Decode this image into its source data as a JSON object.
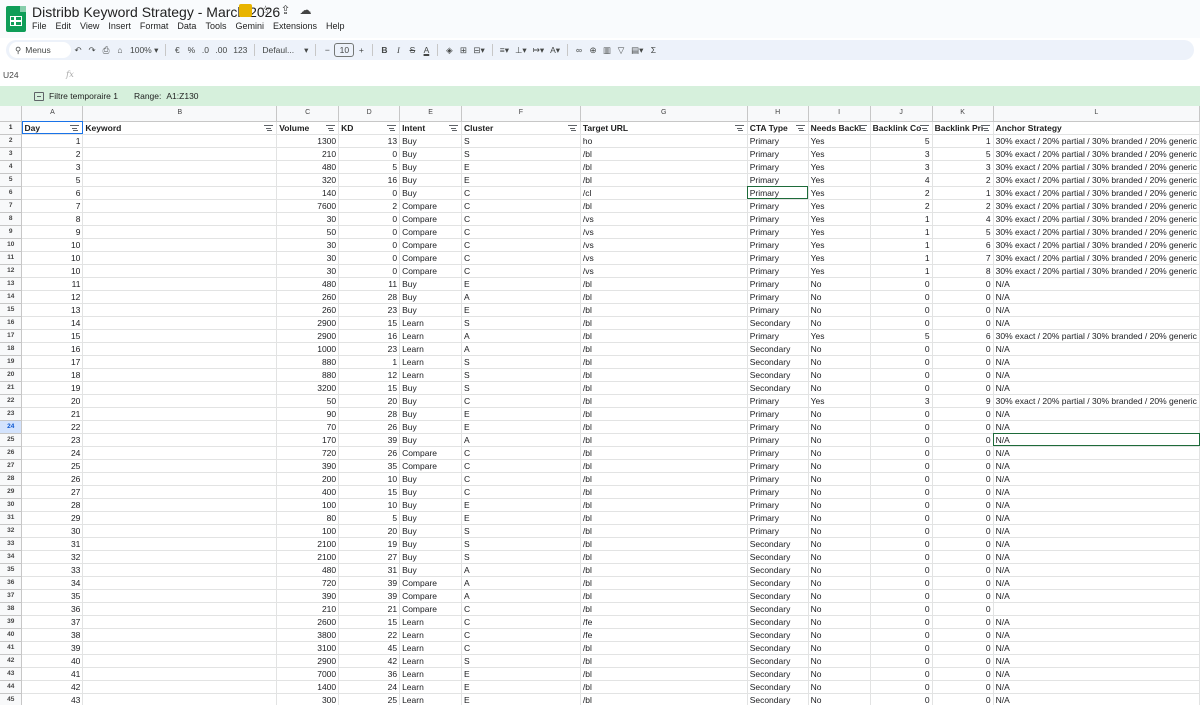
{
  "window": {
    "title": "Distribb Keyword Strategy - March 2026"
  },
  "menu": [
    "File",
    "Edit",
    "View",
    "Insert",
    "Format",
    "Data",
    "Tools",
    "Gemini",
    "Extensions",
    "Help"
  ],
  "toolbar": {
    "menus_label": "Menus",
    "zoom": "100%",
    "currency": "€",
    "percent": "%",
    "decrease_decimal": ".0",
    "increase_decimal": ".00",
    "number_format": "123",
    "font": "Defaul...",
    "font_size": "10",
    "bold": "B",
    "italic": "I",
    "strikethrough": "S",
    "text_color": "A",
    "sum": "Σ"
  },
  "formula_bar": {
    "cell_ref": "U24",
    "fx": "fx",
    "content": ""
  },
  "filter_bar": {
    "name": "Filtre temporaire 1",
    "range_label": "Range:",
    "range": "A1:Z130"
  },
  "columns": [
    "A",
    "B",
    "C",
    "D",
    "E",
    "F",
    "G",
    "H",
    "I",
    "J",
    "K",
    "L"
  ],
  "headers": [
    "Day",
    "Keyword",
    "Volume",
    "KD",
    "Intent",
    "Cluster",
    "Target URL",
    "CTA Type",
    "Needs Backl",
    "Backlink Co",
    "Backlink Pri",
    "Anchor Strategy"
  ],
  "rows": [
    {
      "n": "2",
      "day": "1",
      "kw": "",
      "vol": "1300",
      "kd": "13",
      "intent": "Buy",
      "cluster": "S",
      "url": "ho",
      "cta": "Primary",
      "needs": "Yes",
      "bc": "5",
      "bp": "1",
      "anchor": "30% exact / 20% partial / 30% branded / 20% generic"
    },
    {
      "n": "3",
      "day": "2",
      "kw": "",
      "vol": "210",
      "kd": "0",
      "intent": "Buy",
      "cluster": "S",
      "url": "/bl",
      "cta": "Primary",
      "needs": "Yes",
      "bc": "3",
      "bp": "5",
      "anchor": "30% exact / 20% partial / 30% branded / 20% generic"
    },
    {
      "n": "4",
      "day": "3",
      "kw": "",
      "vol": "480",
      "kd": "5",
      "intent": "Buy",
      "cluster": "E",
      "url": "/bl",
      "cta": "Primary",
      "needs": "Yes",
      "bc": "3",
      "bp": "3",
      "anchor": "30% exact / 20% partial / 30% branded / 20% generic"
    },
    {
      "n": "5",
      "day": "5",
      "kw": "",
      "vol": "320",
      "kd": "16",
      "intent": "Buy",
      "cluster": "E",
      "url": "/bl",
      "cta": "Primary",
      "needs": "Yes",
      "bc": "4",
      "bp": "2",
      "anchor": "30% exact / 20% partial / 30% branded / 20% generic"
    },
    {
      "n": "6",
      "day": "6",
      "kw": "",
      "vol": "140",
      "kd": "0",
      "intent": "Buy",
      "cluster": "C",
      "url": "/cl",
      "cta": "Primary",
      "needs": "Yes",
      "bc": "2",
      "bp": "1",
      "anchor": "30% exact / 20% partial / 30% branded / 20% generic"
    },
    {
      "n": "7",
      "day": "7",
      "kw": "",
      "vol": "7600",
      "kd": "2",
      "intent": "Compare",
      "cluster": "C",
      "url": "/bl",
      "cta": "Primary",
      "needs": "Yes",
      "bc": "2",
      "bp": "2",
      "anchor": "30% exact / 20% partial / 30% branded / 20% generic"
    },
    {
      "n": "8",
      "day": "8",
      "kw": "",
      "vol": "30",
      "kd": "0",
      "intent": "Compare",
      "cluster": "C",
      "url": "/vs",
      "cta": "Primary",
      "needs": "Yes",
      "bc": "1",
      "bp": "4",
      "anchor": "30% exact / 20% partial / 30% branded / 20% generic"
    },
    {
      "n": "9",
      "day": "9",
      "kw": "",
      "vol": "50",
      "kd": "0",
      "intent": "Compare",
      "cluster": "C",
      "url": "/vs",
      "cta": "Primary",
      "needs": "Yes",
      "bc": "1",
      "bp": "5",
      "anchor": "30% exact / 20% partial / 30% branded / 20% generic"
    },
    {
      "n": "10",
      "day": "10",
      "kw": "",
      "vol": "30",
      "kd": "0",
      "intent": "Compare",
      "cluster": "C",
      "url": "/vs",
      "cta": "Primary",
      "needs": "Yes",
      "bc": "1",
      "bp": "6",
      "anchor": "30% exact / 20% partial / 30% branded / 20% generic"
    },
    {
      "n": "11",
      "day": "10",
      "kw": "",
      "vol": "30",
      "kd": "0",
      "intent": "Compare",
      "cluster": "C",
      "url": "/vs",
      "cta": "Primary",
      "needs": "Yes",
      "bc": "1",
      "bp": "7",
      "anchor": "30% exact / 20% partial / 30% branded / 20% generic"
    },
    {
      "n": "12",
      "day": "10",
      "kw": "",
      "vol": "30",
      "kd": "0",
      "intent": "Compare",
      "cluster": "C",
      "url": "/vs",
      "cta": "Primary",
      "needs": "Yes",
      "bc": "1",
      "bp": "8",
      "anchor": "30% exact / 20% partial / 30% branded / 20% generic"
    },
    {
      "n": "13",
      "day": "11",
      "kw": "",
      "vol": "480",
      "kd": "11",
      "intent": "Buy",
      "cluster": "E",
      "url": "/bl",
      "cta": "Primary",
      "needs": "No",
      "bc": "0",
      "bp": "0",
      "anchor": "N/A"
    },
    {
      "n": "14",
      "day": "12",
      "kw": "",
      "vol": "260",
      "kd": "28",
      "intent": "Buy",
      "cluster": "A",
      "url": "/bl",
      "cta": "Primary",
      "needs": "No",
      "bc": "0",
      "bp": "0",
      "anchor": "N/A"
    },
    {
      "n": "15",
      "day": "13",
      "kw": "",
      "vol": "260",
      "kd": "23",
      "intent": "Buy",
      "cluster": "E",
      "url": "/bl",
      "cta": "Primary",
      "needs": "No",
      "bc": "0",
      "bp": "0",
      "anchor": "N/A"
    },
    {
      "n": "16",
      "day": "14",
      "kw": "",
      "vol": "2900",
      "kd": "15",
      "intent": "Learn",
      "cluster": "S",
      "url": "/bl",
      "cta": "Secondary",
      "needs": "No",
      "bc": "0",
      "bp": "0",
      "anchor": "N/A"
    },
    {
      "n": "17",
      "day": "15",
      "kw": "",
      "vol": "2900",
      "kd": "16",
      "intent": "Learn",
      "cluster": "A",
      "url": "/bl",
      "cta": "Primary",
      "needs": "Yes",
      "bc": "5",
      "bp": "6",
      "anchor": "30% exact / 20% partial / 30% branded / 20% generic"
    },
    {
      "n": "18",
      "day": "16",
      "kw": "",
      "vol": "1000",
      "kd": "23",
      "intent": "Learn",
      "cluster": "A",
      "url": "/bl",
      "cta": "Secondary",
      "needs": "No",
      "bc": "0",
      "bp": "0",
      "anchor": "N/A"
    },
    {
      "n": "19",
      "day": "17",
      "kw": "",
      "vol": "880",
      "kd": "1",
      "intent": "Learn",
      "cluster": "S",
      "url": "/bl",
      "cta": "Secondary",
      "needs": "No",
      "bc": "0",
      "bp": "0",
      "anchor": "N/A"
    },
    {
      "n": "20",
      "day": "18",
      "kw": "",
      "vol": "880",
      "kd": "12",
      "intent": "Learn",
      "cluster": "S",
      "url": "/bl",
      "cta": "Secondary",
      "needs": "No",
      "bc": "0",
      "bp": "0",
      "anchor": "N/A"
    },
    {
      "n": "21",
      "day": "19",
      "kw": "",
      "vol": "3200",
      "kd": "15",
      "intent": "Buy",
      "cluster": "S",
      "url": "/bl",
      "cta": "Secondary",
      "needs": "No",
      "bc": "0",
      "bp": "0",
      "anchor": "N/A"
    },
    {
      "n": "22",
      "day": "20",
      "kw": "",
      "vol": "50",
      "kd": "20",
      "intent": "Buy",
      "cluster": "C",
      "url": "/bl",
      "cta": "Primary",
      "needs": "Yes",
      "bc": "3",
      "bp": "9",
      "anchor": "30% exact / 20% partial / 30% branded / 20% generic"
    },
    {
      "n": "23",
      "day": "21",
      "kw": "",
      "vol": "90",
      "kd": "28",
      "intent": "Buy",
      "cluster": "E",
      "url": "/bl",
      "cta": "Primary",
      "needs": "No",
      "bc": "0",
      "bp": "0",
      "anchor": "N/A"
    },
    {
      "n": "24",
      "day": "22",
      "kw": "",
      "vol": "70",
      "kd": "26",
      "intent": "Buy",
      "cluster": "E",
      "url": "/bl",
      "cta": "Primary",
      "needs": "No",
      "bc": "0",
      "bp": "0",
      "anchor": "N/A"
    },
    {
      "n": "25",
      "day": "23",
      "kw": "",
      "vol": "170",
      "kd": "39",
      "intent": "Buy",
      "cluster": "A",
      "url": "/bl",
      "cta": "Primary",
      "needs": "No",
      "bc": "0",
      "bp": "0",
      "anchor": "N/A"
    },
    {
      "n": "26",
      "day": "24",
      "kw": "",
      "vol": "720",
      "kd": "26",
      "intent": "Compare",
      "cluster": "C",
      "url": "/bl",
      "cta": "Primary",
      "needs": "No",
      "bc": "0",
      "bp": "0",
      "anchor": "N/A"
    },
    {
      "n": "27",
      "day": "25",
      "kw": "",
      "vol": "390",
      "kd": "35",
      "intent": "Compare",
      "cluster": "C",
      "url": "/bl",
      "cta": "Primary",
      "needs": "No",
      "bc": "0",
      "bp": "0",
      "anchor": "N/A"
    },
    {
      "n": "28",
      "day": "26",
      "kw": "",
      "vol": "200",
      "kd": "10",
      "intent": "Buy",
      "cluster": "C",
      "url": "/bl",
      "cta": "Primary",
      "needs": "No",
      "bc": "0",
      "bp": "0",
      "anchor": "N/A"
    },
    {
      "n": "29",
      "day": "27",
      "kw": "",
      "vol": "400",
      "kd": "15",
      "intent": "Buy",
      "cluster": "C",
      "url": "/bl",
      "cta": "Primary",
      "needs": "No",
      "bc": "0",
      "bp": "0",
      "anchor": "N/A"
    },
    {
      "n": "30",
      "day": "28",
      "kw": "",
      "vol": "100",
      "kd": "10",
      "intent": "Buy",
      "cluster": "E",
      "url": "/bl",
      "cta": "Primary",
      "needs": "No",
      "bc": "0",
      "bp": "0",
      "anchor": "N/A"
    },
    {
      "n": "31",
      "day": "29",
      "kw": "",
      "vol": "80",
      "kd": "5",
      "intent": "Buy",
      "cluster": "E",
      "url": "/bl",
      "cta": "Primary",
      "needs": "No",
      "bc": "0",
      "bp": "0",
      "anchor": "N/A"
    },
    {
      "n": "32",
      "day": "30",
      "kw": "",
      "vol": "100",
      "kd": "20",
      "intent": "Buy",
      "cluster": "S",
      "url": "/bl",
      "cta": "Primary",
      "needs": "No",
      "bc": "0",
      "bp": "0",
      "anchor": "N/A"
    },
    {
      "n": "33",
      "day": "31",
      "kw": "",
      "vol": "2100",
      "kd": "19",
      "intent": "Buy",
      "cluster": "S",
      "url": "/bl",
      "cta": "Secondary",
      "needs": "No",
      "bc": "0",
      "bp": "0",
      "anchor": "N/A"
    },
    {
      "n": "34",
      "day": "32",
      "kw": "",
      "vol": "2100",
      "kd": "27",
      "intent": "Buy",
      "cluster": "S",
      "url": "/bl",
      "cta": "Secondary",
      "needs": "No",
      "bc": "0",
      "bp": "0",
      "anchor": "N/A"
    },
    {
      "n": "35",
      "day": "33",
      "kw": "",
      "vol": "480",
      "kd": "31",
      "intent": "Buy",
      "cluster": "A",
      "url": "/bl",
      "cta": "Secondary",
      "needs": "No",
      "bc": "0",
      "bp": "0",
      "anchor": "N/A"
    },
    {
      "n": "36",
      "day": "34",
      "kw": "",
      "vol": "720",
      "kd": "39",
      "intent": "Compare",
      "cluster": "A",
      "url": "/bl",
      "cta": "Secondary",
      "needs": "No",
      "bc": "0",
      "bp": "0",
      "anchor": "N/A"
    },
    {
      "n": "37",
      "day": "35",
      "kw": "",
      "vol": "390",
      "kd": "39",
      "intent": "Compare",
      "cluster": "A",
      "url": "/bl",
      "cta": "Secondary",
      "needs": "No",
      "bc": "0",
      "bp": "0",
      "anchor": "N/A"
    },
    {
      "n": "38",
      "day": "36",
      "kw": "",
      "vol": "210",
      "kd": "21",
      "intent": "Compare",
      "cluster": "C",
      "url": "/bl",
      "cta": "Secondary",
      "needs": "No",
      "bc": "0",
      "bp": "0",
      "anchor": ""
    },
    {
      "n": "39",
      "day": "37",
      "kw": "",
      "vol": "2600",
      "kd": "15",
      "intent": "Learn",
      "cluster": "C",
      "url": "/fe",
      "cta": "Secondary",
      "needs": "No",
      "bc": "0",
      "bp": "0",
      "anchor": "N/A"
    },
    {
      "n": "40",
      "day": "38",
      "kw": "",
      "vol": "3800",
      "kd": "22",
      "intent": "Learn",
      "cluster": "C",
      "url": "/fe",
      "cta": "Secondary",
      "needs": "No",
      "bc": "0",
      "bp": "0",
      "anchor": "N/A"
    },
    {
      "n": "41",
      "day": "39",
      "kw": "",
      "vol": "3100",
      "kd": "45",
      "intent": "Learn",
      "cluster": "C",
      "url": "/bl",
      "cta": "Secondary",
      "needs": "No",
      "bc": "0",
      "bp": "0",
      "anchor": "N/A"
    },
    {
      "n": "42",
      "day": "40",
      "kw": "",
      "vol": "2900",
      "kd": "42",
      "intent": "Learn",
      "cluster": "S",
      "url": "/bl",
      "cta": "Secondary",
      "needs": "No",
      "bc": "0",
      "bp": "0",
      "anchor": "N/A"
    },
    {
      "n": "43",
      "day": "41",
      "kw": "",
      "vol": "7000",
      "kd": "36",
      "intent": "Learn",
      "cluster": "E",
      "url": "/bl",
      "cta": "Secondary",
      "needs": "No",
      "bc": "0",
      "bp": "0",
      "anchor": "N/A"
    },
    {
      "n": "44",
      "day": "42",
      "kw": "",
      "vol": "1400",
      "kd": "24",
      "intent": "Learn",
      "cluster": "E",
      "url": "/bl",
      "cta": "Secondary",
      "needs": "No",
      "bc": "0",
      "bp": "0",
      "anchor": "N/A"
    },
    {
      "n": "45",
      "day": "43",
      "kw": "",
      "vol": "300",
      "kd": "25",
      "intent": "Learn",
      "cluster": "E",
      "url": "/bl",
      "cta": "Secondary",
      "needs": "No",
      "bc": "0",
      "bp": "0",
      "anchor": "N/A"
    }
  ],
  "colors": {
    "filter_bar_bg": "#d6f0dc",
    "toolbar_bg": "#edf2fa",
    "active_cell_border": "#1e6b3a",
    "app_icon": "#0f9d58"
  }
}
